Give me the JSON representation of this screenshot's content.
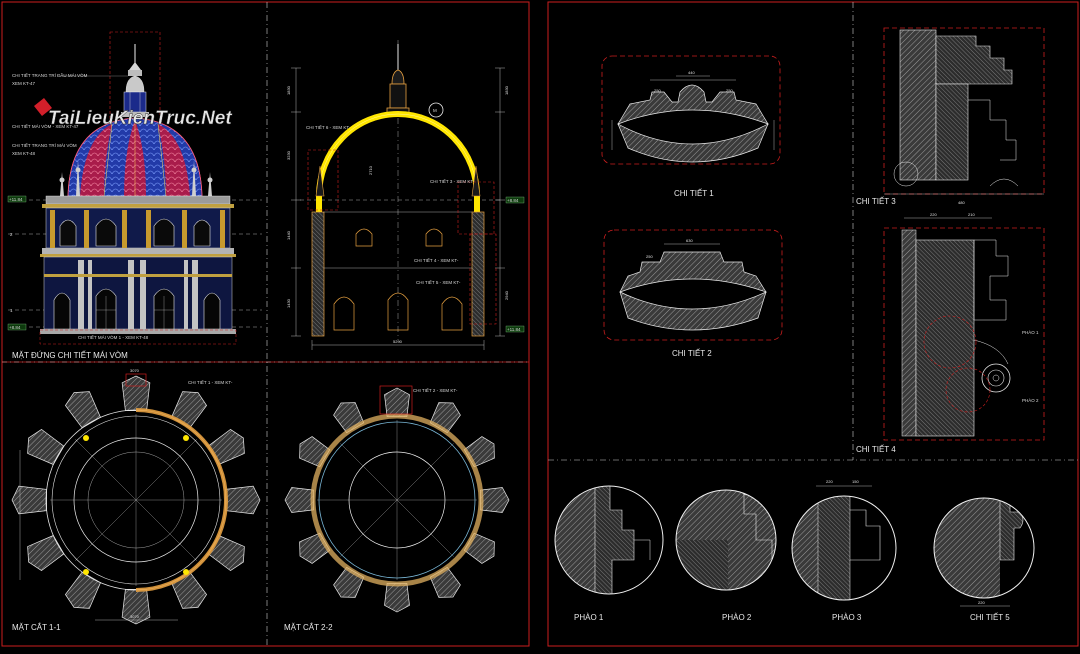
{
  "watermark": "TaiLieuKienTruc.Net",
  "left_sheet": {
    "elevation_title": "MẶT ĐỨNG CHI TIẾT MÁI VÒM",
    "section_1_title": "MẶT CẮT 1-1",
    "section_2_title": "MẶT CẮT 2-2",
    "callouts": {
      "finial": "CHI TIẾT TRANG TRÍ ĐẦU MÁI VÒM",
      "finial_ref": "XEM KT-47",
      "dome": "CHI TIẾT MÁI VÒM - XEM KT-47",
      "ornament": "CHI TIẾT TRANG TRÍ MÁI VÒM",
      "ornament_ref": "XEM KT-48",
      "base": "CHI TIẾT MÁI VÒM 1 - XEM KT-48",
      "detail_6": "CHI TIẾT 6 - XEM KT-",
      "detail_3": "CHI TIẾT 3 - XEM KT-",
      "detail_4": "CHI TIẾT 4 - XEM KT-",
      "detail_5": "CHI TIẾT 5 - XEM KT-",
      "detail_1": "CHI TIẾT 1 - XEM KT-",
      "detail_2": "CHI TIẾT 2 - XEM KT-"
    },
    "grid_marks": [
      "3",
      "2",
      "1"
    ],
    "level_marks": [
      "+8.84",
      "+11.84"
    ],
    "section_mark": "M",
    "dims": {
      "span": "5290",
      "radius": "2710",
      "h1": "1830",
      "h2": "2940",
      "h3": "1440",
      "h4": "3230",
      "h5": "1430",
      "w1": "3070",
      "w2": "630",
      "w3": "250",
      "w4": "440",
      "w5": "420",
      "w6": "220",
      "w7": "210",
      "w8": "150",
      "w9": "480"
    }
  },
  "right_sheet": {
    "detail_1": "CHI TIẾT 1",
    "detail_2": "CHI TIẾT 2",
    "detail_3": "CHI TIẾT 3",
    "detail_4": "CHI TIẾT 4",
    "detail_5": "CHI TIẾT 5",
    "phao_1": "PHÀO 1",
    "phao_2": "PHÀO 2",
    "phao_3": "PHÀO 3",
    "tag_phao_1": "PHÀO 1",
    "tag_phao_2": "PHÀO 2"
  },
  "colors": {
    "frame": "#cc1e1e",
    "cut_line": "#ffe600",
    "dome_blue": "#2a3cc8",
    "dome_red": "#c41a44",
    "hatch": "#8a8a8a",
    "line_white": "#e6e6e6"
  }
}
